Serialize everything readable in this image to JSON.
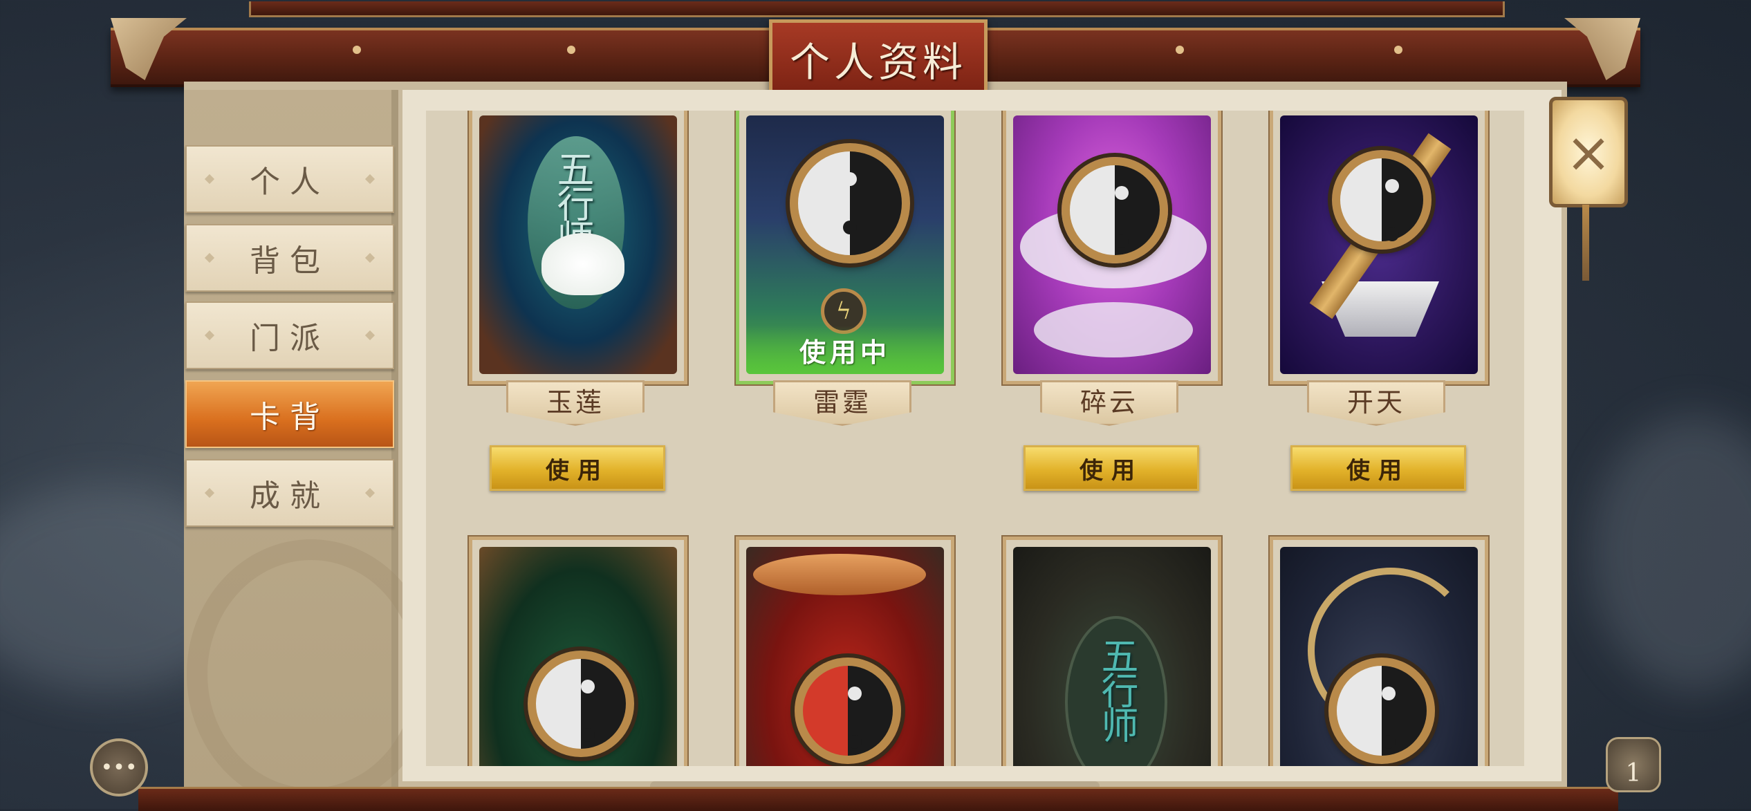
{
  "title": "个人资料",
  "sidebar": {
    "tabs": [
      {
        "label": "个人"
      },
      {
        "label": "背包"
      },
      {
        "label": "门派"
      },
      {
        "label": "卡背",
        "active": true
      },
      {
        "label": "成就"
      }
    ]
  },
  "cards_row1": [
    {
      "name": "玉莲",
      "button": "使用",
      "art_text": "五行师",
      "in_use": false
    },
    {
      "name": "雷霆",
      "status": "使用中",
      "in_use": true
    },
    {
      "name": "碎云",
      "button": "使用",
      "in_use": false
    },
    {
      "name": "开天",
      "button": "使用",
      "in_use": false
    }
  ],
  "cards_row2": [
    {
      "art": "green-bagua"
    },
    {
      "art": "red-swirl"
    },
    {
      "art": "teal-emblem",
      "art_text": "五行师"
    },
    {
      "art": "navy-gold-swirl"
    }
  ],
  "close_icon": "×",
  "chat_icon": "•••",
  "counter": "1",
  "colors": {
    "active_tab": "#e07a25",
    "use_button": "#e8bd35",
    "in_use": "#5bbf3a",
    "frame": "#5a2314"
  }
}
